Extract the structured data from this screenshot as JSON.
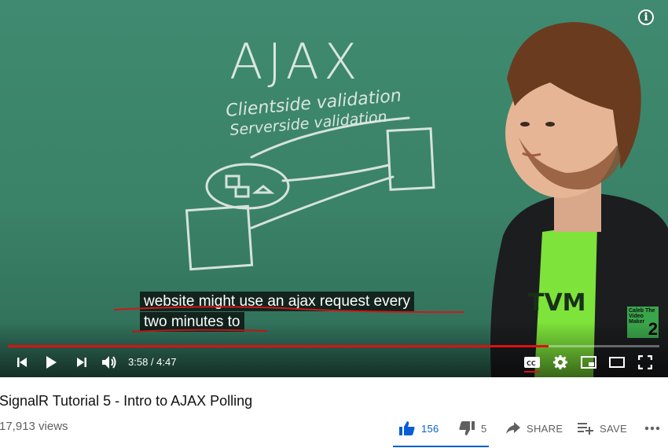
{
  "video": {
    "caption_line1": "website might use an ajax request every",
    "caption_line2": "two minutes to",
    "info_icon": "info-icon",
    "watermark_text": "Caleb The Video Maker",
    "watermark_number": "2",
    "board_title": "AJAX",
    "board_line1": "Clientside validation",
    "board_line2": "Serverside validation",
    "shirt_text": "TVM"
  },
  "player": {
    "current_time": "3:58",
    "duration": "4:47",
    "time_display": "3:58 / 4:47",
    "progress_fraction": 0.83,
    "accent_color": "#e01010",
    "icons": [
      "prev-icon",
      "play-icon",
      "next-icon",
      "volume-icon",
      "captions-icon",
      "settings-icon",
      "miniplayer-icon",
      "theater-icon",
      "fullscreen-icon"
    ]
  },
  "meta": {
    "title": "SignalR Tutorial 5 - Intro to AJAX Polling",
    "views": "17,913 views",
    "likes": "156",
    "dislikes": "5",
    "share_label": "SHARE",
    "save_label": "SAVE",
    "like_color": "#065fd4"
  }
}
